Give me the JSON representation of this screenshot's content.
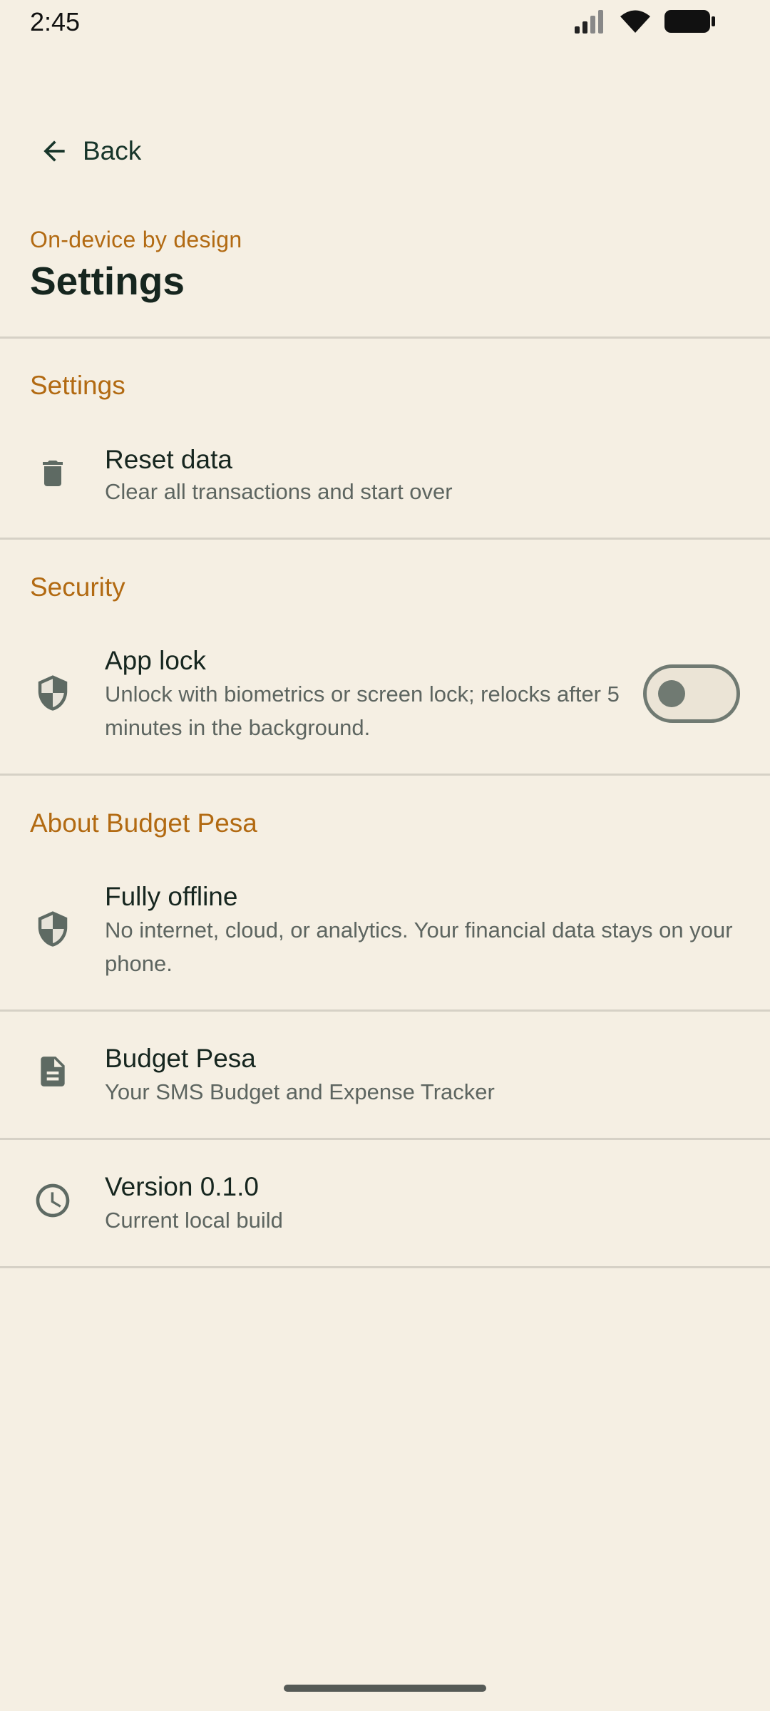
{
  "status_bar": {
    "time": "2:45",
    "icons": [
      "signal-icon",
      "wifi-icon",
      "battery-icon"
    ]
  },
  "nav": {
    "back_label": "Back"
  },
  "header": {
    "eyebrow": "On-device by design",
    "title": "Settings"
  },
  "sections": {
    "settings": {
      "title": "Settings",
      "reset": {
        "title": "Reset data",
        "subtitle": "Clear all transactions and start over",
        "icon": "trash-icon"
      }
    },
    "security": {
      "title": "Security",
      "app_lock": {
        "title": "App lock",
        "subtitle_line1": "Unlock with biometrics or screen lock; relocks after 5",
        "subtitle_line2": "minutes in the background.",
        "icon": "shield-icon",
        "toggle_on": false
      }
    },
    "about": {
      "title": "About Budget Pesa",
      "offline": {
        "title": "Fully offline",
        "subtitle_line1": "No internet, cloud, or analytics. Your financial data stays on your",
        "subtitle_line2": "phone.",
        "icon": "shield-icon"
      },
      "app": {
        "title": "Budget Pesa",
        "subtitle": "Your SMS Budget and Expense Tracker",
        "icon": "document-icon"
      },
      "version": {
        "title": "Version 0.1.0",
        "subtitle": "Current local build",
        "icon": "clock-icon"
      }
    }
  },
  "colors": {
    "background": "#f5efe3",
    "accent": "#b26a12",
    "icon": "#5e6a63",
    "divider": "#d6d1c6"
  }
}
